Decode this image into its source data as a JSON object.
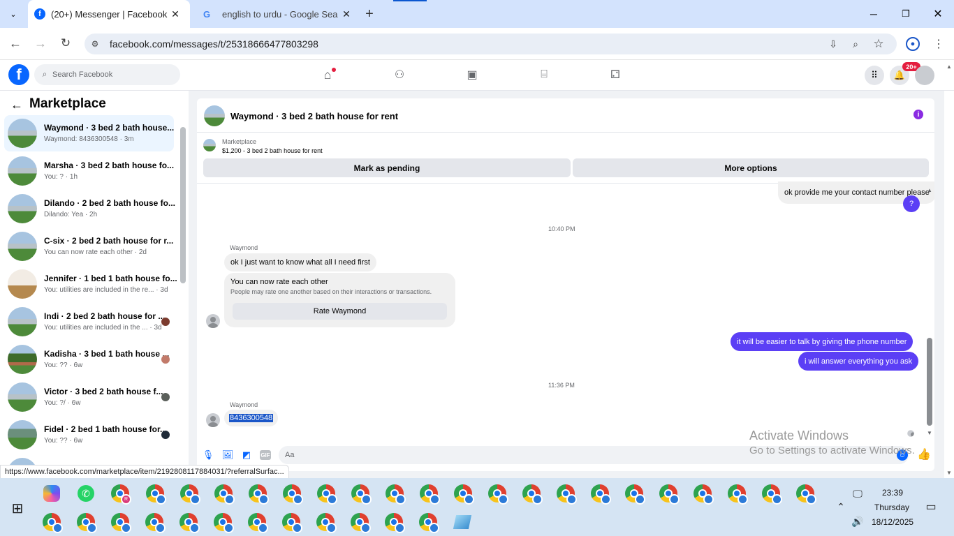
{
  "browser": {
    "tabs": [
      {
        "title": "(20+) Messenger | Facebook"
      },
      {
        "title": "english to urdu - Google Search"
      }
    ],
    "url": "facebook.com/messages/t/25318666477803298"
  },
  "fb": {
    "search_placeholder": "Search Facebook",
    "notif_badge": "20+"
  },
  "sidebar": {
    "title": "Marketplace",
    "conversations": [
      {
        "name": "Waymond · 3 bed 2 bath house...",
        "preview": "Waymond: 8436300548 · 3m",
        "active": true
      },
      {
        "name": "Marsha · 3 bed 2 bath house fo...",
        "preview": "You: ? · 1h"
      },
      {
        "name": "Dilando · 2 bed 2 bath house fo...",
        "preview": "Dilando: Yea · 2h"
      },
      {
        "name": "C-six · 2 bed 2 bath house for r...",
        "preview": "You can now rate each other · 2d"
      },
      {
        "name": "Jennifer · 1 bed 1 bath house fo...",
        "preview": "You: utilities are included in the re... · 3d"
      },
      {
        "name": "Indi · 2 bed 2 bath house for ...",
        "preview": "You: utilities are included in the ... · 3d"
      },
      {
        "name": "Kadisha · 3 bed 1 bath house ...",
        "preview": "You: ?? · 6w"
      },
      {
        "name": "Victor · 3 bed 2 bath house f...",
        "preview": "You: ?/ · 6w"
      },
      {
        "name": "Fidel · 2 bed 1 bath house for...",
        "preview": "You: ?? · 6w"
      }
    ]
  },
  "chat": {
    "title": "Waymond · 3 bed 2 bath house for rent",
    "listing_label": "Marketplace",
    "listing_detail": "$1,200 - 3 bed 2 bath house for rent",
    "mark_pending": "Mark as pending",
    "more_options": "More options",
    "msg_out_top": "ok provide me your contact number please",
    "msg_out_q": "?",
    "time1": "10:40 PM",
    "sender1": "Waymond",
    "msg_in1": "ok I just want to know what all I need first",
    "rate_title": "You can now rate each other",
    "rate_sub": "People may rate one another based on their interactions or transactions.",
    "rate_button": "Rate Waymond",
    "msg_out2": "it will be easier to talk by giving the phone number",
    "msg_out3": "i will answer everything you ask",
    "time2": "11:36 PM",
    "sender2": "Waymond",
    "msg_in2": "8436300548",
    "composer_placeholder": "Aa"
  },
  "watermark": {
    "line1": "Activate Windows",
    "line2": "Go to Settings to activate Windows."
  },
  "status_url": "https://www.facebook.com/marketplace/item/2192808117884031/?referralSurfac...",
  "taskbar": {
    "time": "23:39",
    "day": "Thursday",
    "date": "18/12/2025"
  },
  "colors": {
    "fb_blue": "#0866ff",
    "messenger_purple": "#5b3ff5",
    "tab_strip": "#d3e3fd",
    "taskbar": "#d5e4f3"
  }
}
